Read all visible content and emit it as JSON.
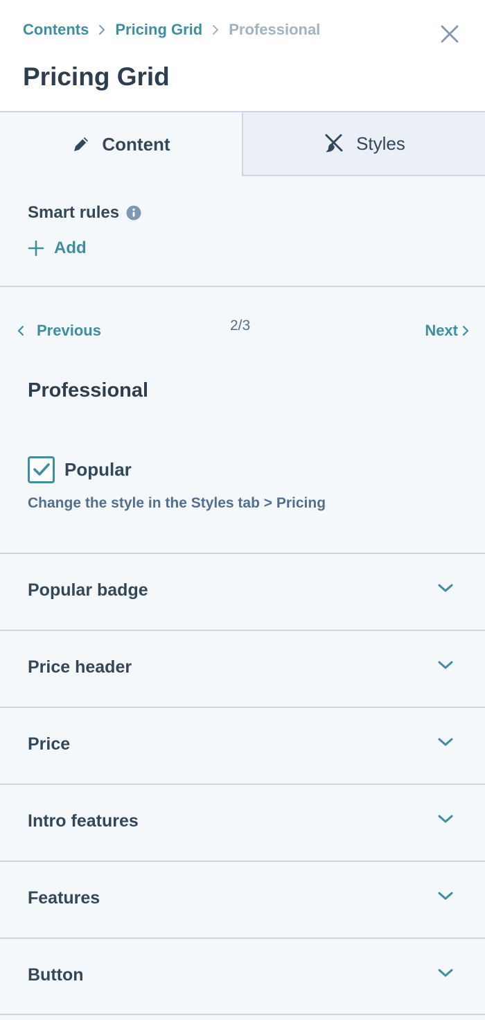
{
  "breadcrumb": {
    "items": [
      "Contents",
      "Pricing Grid",
      "Professional"
    ]
  },
  "page_title": "Pricing Grid",
  "tabs": [
    {
      "label": "Content",
      "icon": "pencil-icon",
      "active": true
    },
    {
      "label": "Styles",
      "icon": "paintbrush-icon",
      "active": false
    }
  ],
  "smart_rules": {
    "label": "Smart rules",
    "add_label": "Add"
  },
  "pager": {
    "previous_label": "Previous",
    "count": "2/3",
    "next_label": "Next"
  },
  "item": {
    "title": "Professional",
    "popular_label": "Popular",
    "popular_checked": true,
    "help_text": "Change the style in the Styles tab > Pricing"
  },
  "sections": [
    {
      "label": "Popular badge"
    },
    {
      "label": "Price header"
    },
    {
      "label": "Price"
    },
    {
      "label": "Intro features"
    },
    {
      "label": "Features"
    },
    {
      "label": "Button"
    }
  ],
  "colors": {
    "accent": "#3d8ea0",
    "text": "#33475b",
    "muted": "#9fb3c5",
    "background": "#f5f8fa",
    "border": "#cbd6e2"
  }
}
